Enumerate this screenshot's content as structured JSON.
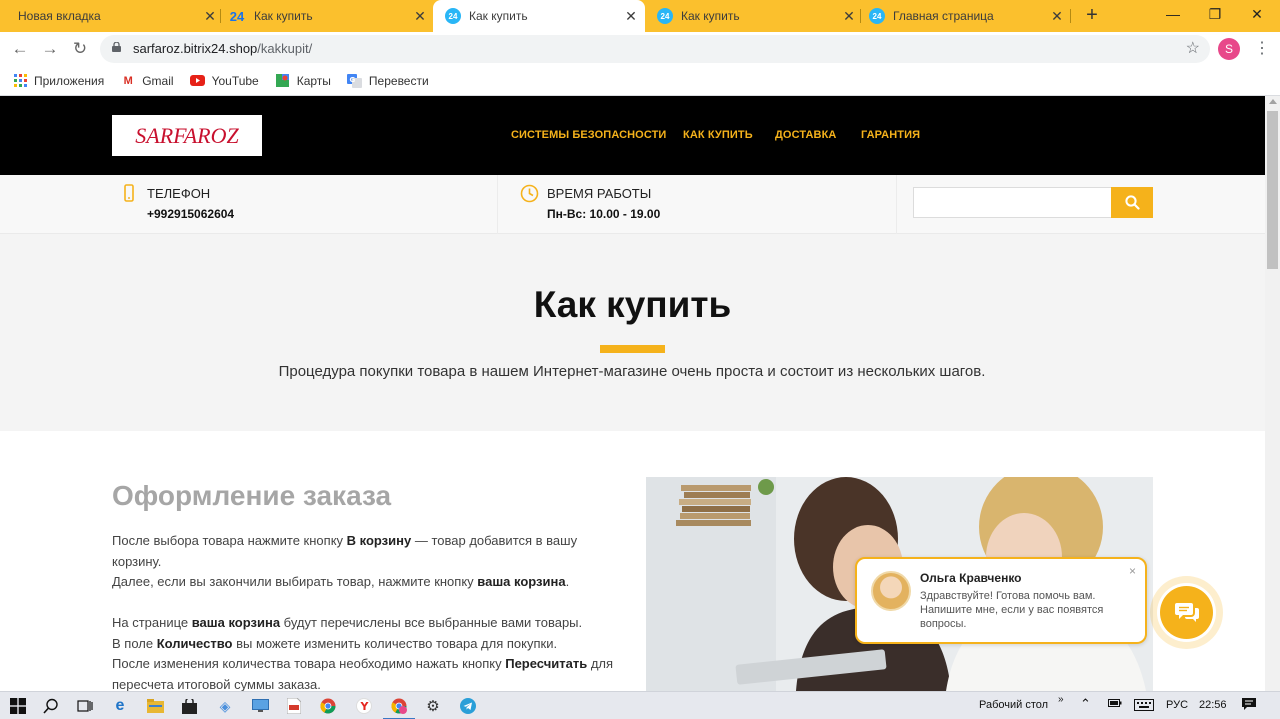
{
  "browser": {
    "tabs": [
      {
        "title": "Новая вкладка",
        "favicon": "none",
        "active": false
      },
      {
        "title": "Как купить",
        "favicon": "24",
        "active": false
      },
      {
        "title": "Как купить",
        "favicon": "24",
        "active": true
      },
      {
        "title": "Как купить",
        "favicon": "24",
        "active": false
      },
      {
        "title": "Главная страница",
        "favicon": "24",
        "active": false
      }
    ],
    "new_tab_label": "+",
    "url_host": "sarfaroz.bitrix24.shop",
    "url_path": "/kakkupit/",
    "profile_initial": "S",
    "bookmarks": [
      {
        "label": "Приложения",
        "icon": "apps-grid-icon"
      },
      {
        "label": "Gmail",
        "icon": "gmail-icon"
      },
      {
        "label": "YouTube",
        "icon": "youtube-icon"
      },
      {
        "label": "Карты",
        "icon": "maps-icon"
      },
      {
        "label": "Перевести",
        "icon": "translate-icon"
      }
    ],
    "accent_color": "#fbc02d"
  },
  "site": {
    "logo_text": "SARFAROZ",
    "nav": [
      "СИСТЕМЫ БЕЗОПАСНОСТИ",
      "КАК КУПИТЬ",
      "ДОСТАВКА",
      "ГАРАНТИЯ"
    ],
    "phone_label": "ТЕЛЕФОН",
    "phone_value": "+992915062604",
    "hours_label": "ВРЕМЯ РАБОТЫ",
    "hours_value": "Пн-Вс: 10.00 - 19.00",
    "search_placeholder": "",
    "accent_color": "#f5b21b"
  },
  "hero": {
    "title": "Как купить",
    "subtitle": "Процедура покупки товара в нашем Интернет-магазине очень проста и состоит из нескольких шагов."
  },
  "content": {
    "heading": "Оформление заказа",
    "p1": [
      {
        "t": "После выбора товара нажмите кнопку ",
        "b": false
      },
      {
        "t": "В корзину",
        "b": true
      },
      {
        "t": " — товар добавится в вашу корзину.",
        "b": false
      }
    ],
    "p2": [
      {
        "t": "Далее, если вы закончили выбирать товар, нажмите кнопку ",
        "b": false
      },
      {
        "t": "ваша корзина",
        "b": true
      },
      {
        "t": ".",
        "b": false
      }
    ],
    "p3": [
      {
        "t": "На странице ",
        "b": false
      },
      {
        "t": "ваша корзина",
        "b": true
      },
      {
        "t": " будут перечислены все выбранные вами товары.",
        "b": false
      }
    ],
    "p4": [
      {
        "t": "В поле ",
        "b": false
      },
      {
        "t": "Количество",
        "b": true
      },
      {
        "t": " вы можете изменить количество товара для покупки.",
        "b": false
      }
    ],
    "p5": [
      {
        "t": "После изменения количества товара необходимо нажать кнопку ",
        "b": false
      },
      {
        "t": "Пересчитать",
        "b": true
      },
      {
        "t": " для пересчета итоговой суммы заказа.",
        "b": false
      }
    ]
  },
  "chat": {
    "name": "Ольга Кравченко",
    "message": "Здравствуйте! Готова помочь вам. Напишите мне, если у вас появятся вопросы.",
    "close": "×"
  },
  "taskbar": {
    "desktop_label": "Рабочий стол",
    "lang": "РУС",
    "time": "22:56"
  }
}
